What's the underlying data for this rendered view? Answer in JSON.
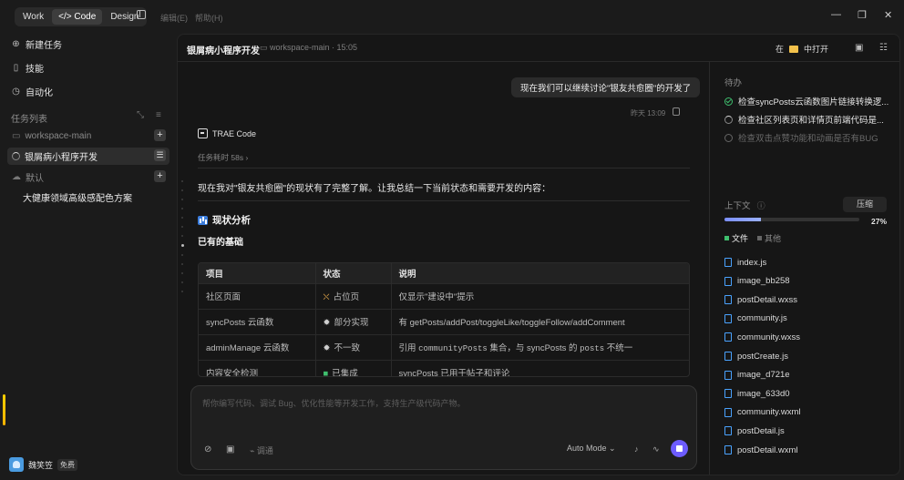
{
  "topbar": {
    "modes": [
      "Work",
      "</> Code",
      "Design"
    ],
    "active_mode": "</> Code",
    "menu": [
      "编辑(E)",
      "帮助(H)"
    ]
  },
  "sidebar": {
    "nav": [
      "新建任务",
      "技能",
      "自动化"
    ],
    "section_title": "任务列表",
    "groups": [
      {
        "name": "workspace-main",
        "tasks": [
          "银屑病小程序开发"
        ]
      },
      {
        "name": "默认",
        "tasks": [
          "大健康领域高级感配色方案"
        ]
      }
    ],
    "user": {
      "name": "魏笑笠",
      "plan": "免费"
    }
  },
  "chat": {
    "title": "银屑病小程序开发",
    "workspace": "workspace-main · 15:05",
    "open_in_prefix": "在",
    "open_in_target": "中打开",
    "user_message": "现在我们可以继续讨论\"银友共愈圈\"的开发了",
    "user_message_time": "昨天 13:09",
    "agent_name": "TRAE Code",
    "task_duration": "任务耗时 58s",
    "summary": "现在我对\"银友共愈圈\"的现状有了完整了解。让我总结一下当前状态和需要开发的内容：",
    "analysis_heading": "现状分析",
    "basis_heading": "已有的基础",
    "table": {
      "headers": [
        "项目",
        "状态",
        "说明"
      ],
      "rows": [
        {
          "item": "社区页面",
          "status_icon": "construction-icon",
          "status": "占位页",
          "note": "仅显示\"建设中\"提示"
        },
        {
          "item": "syncPosts 云函数",
          "status_icon": "gear-icon",
          "status": "部分实现",
          "note": "有 getPosts/addPost/toggleLike/toggleFollow/addComment"
        },
        {
          "item": "adminManage 云函数",
          "status_icon": "gear-icon",
          "status": "不一致",
          "note_pre": "引用",
          "note_code1": "communityPosts",
          "note_mid": "集合，与 syncPosts 的",
          "note_code2": "posts",
          "note_post": "不统一"
        },
        {
          "item": "内容安全检测",
          "status_icon": "green-check-icon",
          "status": "已集成",
          "note": "syncPosts 已用于帖子和评论"
        }
      ]
    }
  },
  "input": {
    "placeholder": "帮你编写代码、调试 Bug、优化性能等开发工作，支持生产级代码产物。",
    "tool_label": "调通",
    "mode": "Auto Mode"
  },
  "right_panel": {
    "todo_title": "待办",
    "todos": [
      {
        "text": "检查syncPosts云函数图片链接转换逻...",
        "state": "done"
      },
      {
        "text": "检查社区列表页和详情页前端代码是...",
        "state": "active"
      },
      {
        "text": "检查双击点赞功能和动画是否有BUG",
        "state": "pending"
      }
    ],
    "context_title": "上下文",
    "compress_label": "压缩",
    "context_percent": "27%",
    "context_fraction": 0.27,
    "tabs": [
      "文件",
      "其他"
    ],
    "files": [
      "index.js",
      "image_bb258",
      "postDetail.wxss",
      "community.js",
      "community.wxss",
      "postCreate.js",
      "image_d721e",
      "image_633d0",
      "community.wxml",
      "postDetail.js",
      "postDetail.wxml"
    ]
  },
  "colors": {
    "accent": "#6d5cff",
    "success": "#3fbf6e",
    "folder": "#f2c14b",
    "file": "#4aa3ff"
  }
}
